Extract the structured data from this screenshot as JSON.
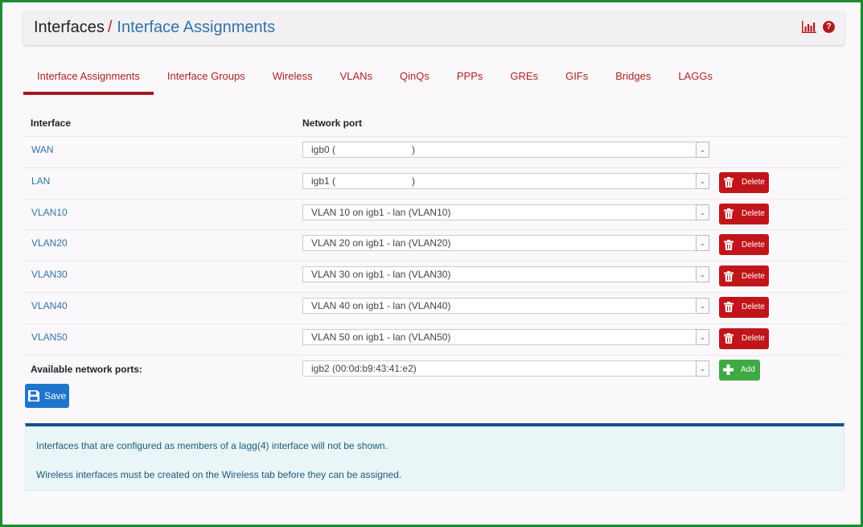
{
  "header": {
    "breadcrumb_root": "Interfaces",
    "breadcrumb_sep": "/",
    "breadcrumb_current": "Interface Assignments",
    "icons": [
      "chart-icon",
      "help-icon"
    ]
  },
  "tabs": [
    {
      "label": "Interface Assignments",
      "active": true
    },
    {
      "label": "Interface Groups"
    },
    {
      "label": "Wireless"
    },
    {
      "label": "VLANs"
    },
    {
      "label": "QinQs"
    },
    {
      "label": "PPPs"
    },
    {
      "label": "GREs"
    },
    {
      "label": "GIFs"
    },
    {
      "label": "Bridges"
    },
    {
      "label": "LAGGs"
    }
  ],
  "table": {
    "col_interface": "Interface",
    "col_port": "Network port",
    "rows": [
      {
        "iface": "WAN",
        "port_prefix": "igb0 (",
        "port_suffix": ")",
        "has_delete": false
      },
      {
        "iface": "LAN",
        "port_prefix": "igb1 (",
        "port_suffix": ")",
        "has_delete": true
      },
      {
        "iface": "VLAN10",
        "port": "VLAN 10 on igb1 - lan (VLAN10)",
        "has_delete": true
      },
      {
        "iface": "VLAN20",
        "port": "VLAN 20 on igb1 - lan (VLAN20)",
        "has_delete": true
      },
      {
        "iface": "VLAN30",
        "port": "VLAN 30 on igb1 - lan (VLAN30)",
        "has_delete": true
      },
      {
        "iface": "VLAN40",
        "port": "VLAN 40 on igb1 - lan (VLAN40)",
        "has_delete": true
      },
      {
        "iface": "VLAN50",
        "port": "VLAN 50 on igb1 - lan (VLAN50)",
        "has_delete": true
      }
    ],
    "available_label": "Available network ports:",
    "available_value": "igb2 (00:0d:b9:43:41:e2)",
    "delete_label": "Delete",
    "add_label": "Add"
  },
  "save_label": "Save",
  "info": {
    "line1": "Interfaces that are configured as members of a lagg(4) interface will not be shown.",
    "line2": "Wireless interfaces must be created on the Wireless tab before they can be assigned."
  },
  "colors": {
    "accent_red": "#a11a22",
    "link_blue": "#2f74a8",
    "delete_red": "#c0151b",
    "add_green": "#3fa944",
    "save_blue": "#1f75cc",
    "frame_green": "#1e8a33"
  }
}
